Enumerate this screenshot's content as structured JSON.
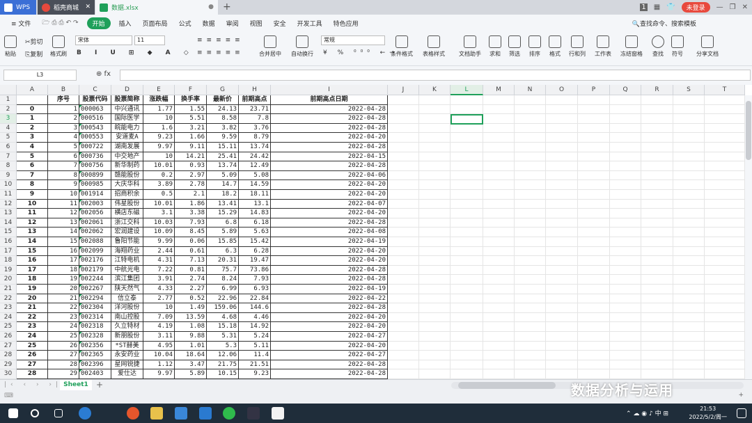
{
  "tabs": [
    {
      "label": "WPS"
    },
    {
      "label": "稻壳商城"
    },
    {
      "label": "数据.xlsx"
    }
  ],
  "login_label": "未登录",
  "menu": [
    "文件",
    "开始",
    "插入",
    "页面布局",
    "公式",
    "数据",
    "审阅",
    "视图",
    "安全",
    "开发工具",
    "特色应用"
  ],
  "search_cmd": "查找命令、搜索模板",
  "ribbon": {
    "font_name": "宋体",
    "font_size": "11",
    "number_format": "常规",
    "paste": "粘贴",
    "cut": "剪切",
    "copy": "复制",
    "format_painter": "格式刷",
    "merge": "合并居中",
    "wrap": "自动换行",
    "buttons": [
      "条件格式",
      "表格样式",
      "文档助手",
      "求和",
      "筛选",
      "排序",
      "格式",
      "行和列",
      "工作表",
      "冻结窗格",
      "查找",
      "符号",
      "分享文档"
    ]
  },
  "name_box": "L3",
  "columns": [
    "A",
    "B",
    "C",
    "D",
    "E",
    "F",
    "G",
    "H",
    "I",
    "J",
    "K",
    "L",
    "M",
    "N",
    "O",
    "P",
    "Q",
    "R",
    "S",
    "T"
  ],
  "headers": [
    "",
    "序号",
    "股票代码",
    "股票简称",
    "涨跌幅",
    "换手率",
    "最新价",
    "前期高点",
    "前期高点日期"
  ],
  "rows": [
    [
      "0",
      "1",
      "000063",
      "中兴通讯",
      "1.77",
      "1.55",
      "24.13",
      "23.71",
      "2022-04-28"
    ],
    [
      "1",
      "2",
      "000516",
      "国际医学",
      "10",
      "5.51",
      "8.58",
      "7.8",
      "2022-04-28"
    ],
    [
      "2",
      "3",
      "000543",
      "皖能电力",
      "1.6",
      "3.21",
      "3.82",
      "3.76",
      "2022-04-28"
    ],
    [
      "3",
      "4",
      "000553",
      "安道麦A",
      "9.23",
      "1.66",
      "9.59",
      "8.79",
      "2022-04-20"
    ],
    [
      "4",
      "5",
      "000722",
      "湖南发展",
      "9.97",
      "9.11",
      "15.11",
      "13.74",
      "2022-04-28"
    ],
    [
      "5",
      "6",
      "000736",
      "中交地产",
      "10",
      "14.21",
      "25.41",
      "24.42",
      "2022-04-15"
    ],
    [
      "6",
      "7",
      "000756",
      "新华制药",
      "10.01",
      "0.93",
      "13.74",
      "12.49",
      "2022-04-28"
    ],
    [
      "7",
      "8",
      "000899",
      "赣能股份",
      "0.2",
      "2.97",
      "5.09",
      "5.08",
      "2022-04-06"
    ],
    [
      "8",
      "9",
      "000985",
      "大庆华科",
      "3.89",
      "2.78",
      "14.7",
      "14.59",
      "2022-04-20"
    ],
    [
      "9",
      "10",
      "001914",
      "招商积余",
      "0.5",
      "2.1",
      "18.2",
      "18.11",
      "2022-04-20"
    ],
    [
      "10",
      "11",
      "002003",
      "伟星股份",
      "10.01",
      "1.86",
      "13.41",
      "13.1",
      "2022-04-07"
    ],
    [
      "11",
      "12",
      "002056",
      "横店东磁",
      "3.1",
      "3.38",
      "15.29",
      "14.83",
      "2022-04-20"
    ],
    [
      "12",
      "13",
      "002061",
      "浙江交科",
      "10.03",
      "7.93",
      "6.8",
      "6.18",
      "2022-04-28"
    ],
    [
      "13",
      "14",
      "002062",
      "宏润建设",
      "10.09",
      "8.45",
      "5.89",
      "5.63",
      "2022-04-08"
    ],
    [
      "14",
      "15",
      "002088",
      "鲁阳节能",
      "9.99",
      "0.06",
      "15.85",
      "15.42",
      "2022-04-19"
    ],
    [
      "15",
      "16",
      "002099",
      "海翔药业",
      "2.44",
      "0.61",
      "6.3",
      "6.28",
      "2022-04-20"
    ],
    [
      "16",
      "17",
      "002176",
      "江特电机",
      "4.31",
      "7.13",
      "20.31",
      "19.47",
      "2022-04-20"
    ],
    [
      "17",
      "18",
      "002179",
      "中航光电",
      "7.22",
      "0.81",
      "75.7",
      "73.86",
      "2022-04-28"
    ],
    [
      "18",
      "19",
      "002244",
      "滨江集团",
      "3.91",
      "2.74",
      "8.24",
      "7.93",
      "2022-04-28"
    ],
    [
      "19",
      "20",
      "002267",
      "陕天然气",
      "4.33",
      "2.27",
      "6.99",
      "6.93",
      "2022-04-19"
    ],
    [
      "20",
      "21",
      "002294",
      "信立泰",
      "2.77",
      "0.52",
      "22.96",
      "22.84",
      "2022-04-22"
    ],
    [
      "21",
      "22",
      "002304",
      "洋河股份",
      "10",
      "1.49",
      "159.06",
      "144.6",
      "2022-04-28"
    ],
    [
      "22",
      "23",
      "002314",
      "南山控股",
      "7.09",
      "13.59",
      "4.68",
      "4.46",
      "2022-04-20"
    ],
    [
      "23",
      "24",
      "002318",
      "久立特材",
      "4.19",
      "1.08",
      "15.18",
      "14.92",
      "2022-04-20"
    ],
    [
      "24",
      "25",
      "002328",
      "新朋股份",
      "3.11",
      "9.88",
      "5.31",
      "5.24",
      "2022-04-27"
    ],
    [
      "25",
      "26",
      "002356",
      "*ST赫美",
      "4.95",
      "1.01",
      "5.3",
      "5.11",
      "2022-04-20"
    ],
    [
      "26",
      "27",
      "002365",
      "永安药业",
      "10.04",
      "18.64",
      "12.06",
      "11.4",
      "2022-04-27"
    ],
    [
      "27",
      "28",
      "002396",
      "星网锐捷",
      "1.12",
      "3.47",
      "21.75",
      "21.51",
      "2022-04-28"
    ],
    [
      "28",
      "29",
      "002403",
      "爱仕达",
      "9.97",
      "5.89",
      "10.15",
      "9.23",
      "2022-04-28"
    ]
  ],
  "sheet": "Sheet1",
  "watermark": "数据分析与运用",
  "clock": {
    "time": "21:53",
    "date": "2022/5/2/周一"
  },
  "ime": "中"
}
